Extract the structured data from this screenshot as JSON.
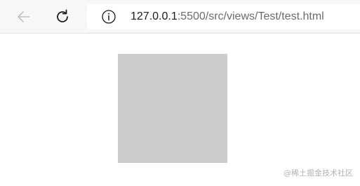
{
  "browser": {
    "url_host": "127.0.0.1",
    "url_path": ":5500/src/views/Test/test.html"
  },
  "watermark": {
    "text": "@稀土掘金技术社区"
  },
  "colors": {
    "box": "#cccccc",
    "toolbar_bg": "#f7f7f7"
  },
  "icons": {
    "back": "arrow-left-icon",
    "reload": "reload-icon",
    "info": "info-icon"
  }
}
